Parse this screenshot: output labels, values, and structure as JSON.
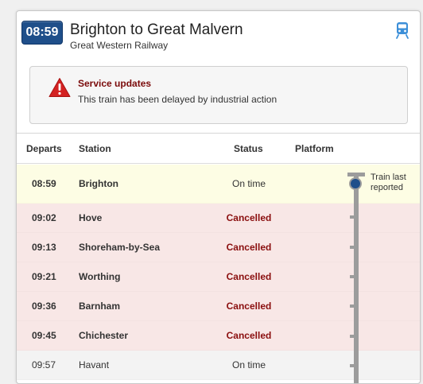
{
  "journey": {
    "departure_time": "08:59",
    "title": "Brighton to Great Malvern",
    "operator": "Great Western Railway"
  },
  "alert": {
    "title": "Service updates",
    "message": "This train has been delayed by industrial action"
  },
  "columns": {
    "departs": "Departs",
    "station": "Station",
    "status": "Status",
    "platform": "Platform"
  },
  "train_position_label": "Train last reported",
  "stops": [
    {
      "time": "08:59",
      "station": "Brighton",
      "status": "On time",
      "state": "current"
    },
    {
      "time": "09:02",
      "station": "Hove",
      "status": "Cancelled",
      "state": "cancelled"
    },
    {
      "time": "09:13",
      "station": "Shoreham-by-Sea",
      "status": "Cancelled",
      "state": "cancelled"
    },
    {
      "time": "09:21",
      "station": "Worthing",
      "status": "Cancelled",
      "state": "cancelled"
    },
    {
      "time": "09:36",
      "station": "Barnham",
      "status": "Cancelled",
      "state": "cancelled"
    },
    {
      "time": "09:45",
      "station": "Chichester",
      "status": "Cancelled",
      "state": "cancelled"
    },
    {
      "time": "09:57",
      "station": "Havant",
      "status": "On time",
      "state": "normal"
    }
  ],
  "icons": {
    "train": "train-icon",
    "warning": "warning-triangle-icon"
  },
  "colors": {
    "badge": "#1f4f8a",
    "cancelled_text": "#8a0e0e",
    "cancelled_row": "#f8e7e6",
    "current_row": "#fdfde4",
    "train_icon": "#3c8fd8",
    "warning": "#d32222"
  }
}
